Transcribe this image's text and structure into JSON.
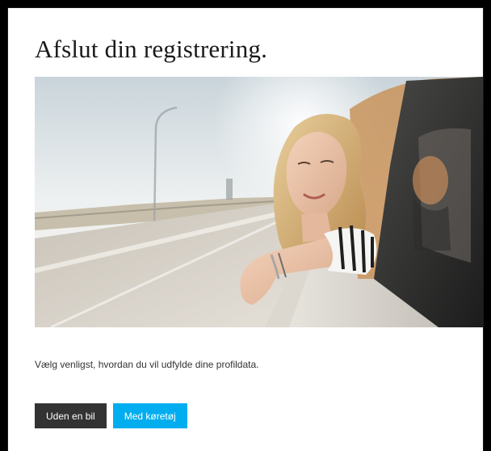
{
  "page": {
    "title": "Afslut din registrering.",
    "prompt": "Vælg venligst, hvordan du vil udfylde dine profildata."
  },
  "actions": {
    "without_car_label": "Uden en bil",
    "with_vehicle_label": "Med køretøj"
  },
  "colors": {
    "without_car_button": "#333333",
    "with_vehicle_button": "#00adef",
    "text": "#1a1a1a"
  },
  "hero": {
    "subject": "woman-leaning-out-of-car-window"
  }
}
